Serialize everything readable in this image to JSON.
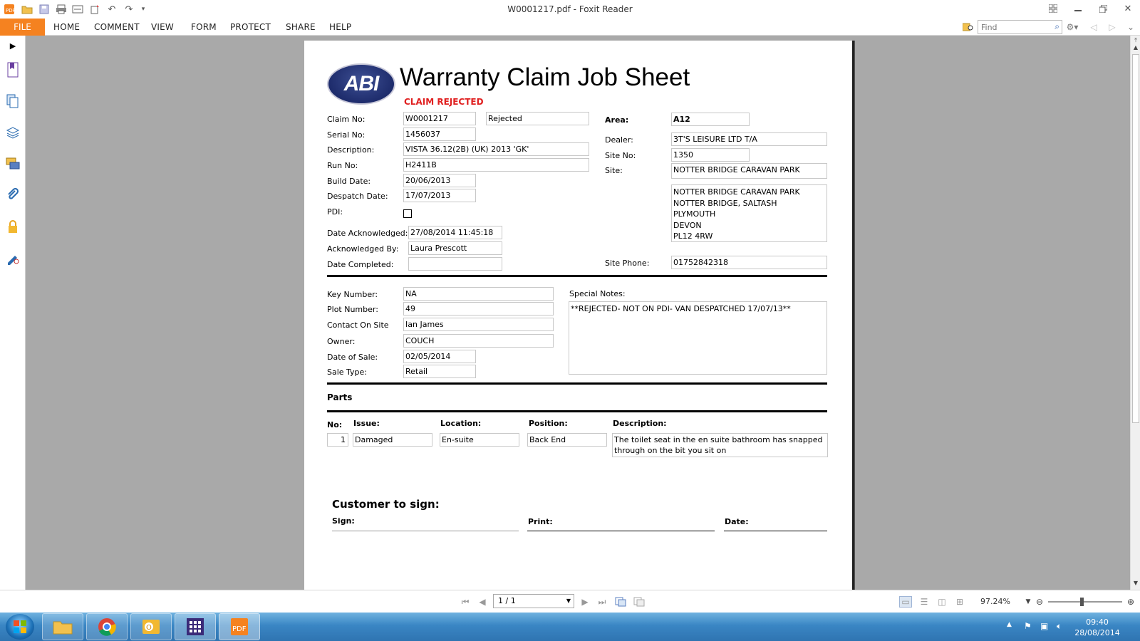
{
  "window": {
    "title": "W0001217.pdf - Foxit Reader"
  },
  "menu": {
    "file": "FILE",
    "items": [
      "HOME",
      "COMMENT",
      "VIEW",
      "FORM",
      "PROTECT",
      "SHARE",
      "HELP"
    ],
    "find_placeholder": "Find"
  },
  "document": {
    "logo_text": "ABI",
    "title": "Warranty Claim Job Sheet",
    "status": "CLAIM REJECTED",
    "left": {
      "claim_no_label": "Claim No:",
      "claim_no": "W0001217",
      "claim_state": "Rejected",
      "serial_no_label": "Serial No:",
      "serial_no": "1456037",
      "description_label": "Description:",
      "description": "VISTA 36.12(2B) (UK) 2013 'GK'",
      "run_no_label": "Run No:",
      "run_no": "H2411B",
      "build_date_label": "Build Date:",
      "build_date": "20/06/2013",
      "despatch_date_label": "Despatch Date:",
      "despatch_date": "17/07/2013",
      "pdi_label": "PDI:",
      "pdi_checked": false,
      "date_ack_label": "Date Acknowledged:",
      "date_ack": "27/08/2014 11:45:18",
      "ack_by_label": "Acknowledged By:",
      "ack_by": "Laura Prescott",
      "date_completed_label": "Date Completed:",
      "date_completed": ""
    },
    "right": {
      "area_label": "Area:",
      "area": "A12",
      "dealer_label": "Dealer:",
      "dealer": "3T'S LEISURE LTD T/A",
      "site_no_label": "Site No:",
      "site_no": "1350",
      "site_label": "Site:",
      "site": "NOTTER BRIDGE CARAVAN PARK",
      "address": [
        "NOTTER BRIDGE CARAVAN PARK",
        "NOTTER BRIDGE, SALTASH",
        "PLYMOUTH",
        "DEVON",
        "PL12 4RW"
      ],
      "site_phone_label": "Site Phone:",
      "site_phone": "01752842318"
    },
    "middle": {
      "key_number_label": "Key Number:",
      "key_number": "NA",
      "plot_number_label": "Plot Number:",
      "plot_number": "49",
      "contact_label": "Contact On Site",
      "contact": "Ian James",
      "owner_label": "Owner:",
      "owner": "COUCH",
      "date_of_sale_label": "Date of Sale:",
      "date_of_sale": "02/05/2014",
      "sale_type_label": "Sale Type:",
      "sale_type": "Retail",
      "special_notes_label": "Special Notes:",
      "special_notes": "**REJECTED- NOT ON PDI- VAN DESPATCHED 17/07/13**"
    },
    "parts": {
      "heading": "Parts",
      "headers": {
        "no": "No:",
        "issue": "Issue:",
        "location": "Location:",
        "position": "Position:",
        "description": "Description:"
      },
      "rows": [
        {
          "no": "1",
          "issue": "Damaged",
          "location": "En-suite",
          "position": "Back End",
          "description": "The toilet seat in the en suite bathroom has snapped through on the bit you sit on"
        }
      ]
    },
    "signature": {
      "heading": "Customer to sign:",
      "sign_label": "Sign:",
      "print_label": "Print:",
      "date_label": "Date:"
    }
  },
  "statusbar": {
    "page": "1 / 1",
    "zoom": "97.24%",
    "zoom_fraction": 0.45
  },
  "taskbar": {
    "time": "09:40",
    "date": "28/08/2014"
  }
}
